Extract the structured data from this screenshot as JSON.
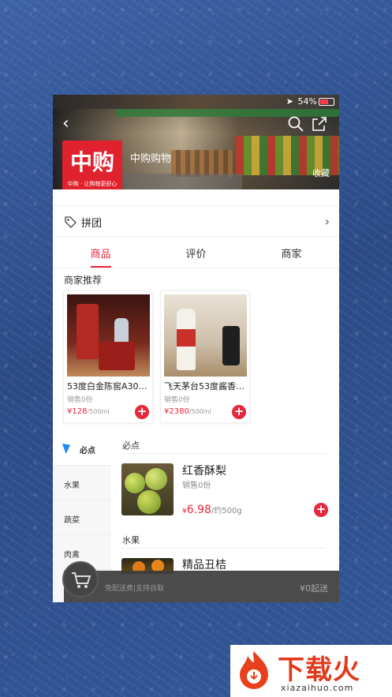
{
  "status_bar": {
    "battery": "54%"
  },
  "header": {
    "shop_name": "中购购物",
    "logo_text": "中购",
    "logo_slogan": "中购 · 让购物更舒心",
    "favorite_label": "收藏"
  },
  "group_buy": {
    "label": "拼团"
  },
  "tabs": [
    {
      "label": "商品",
      "active": true
    },
    {
      "label": "评价",
      "active": false
    },
    {
      "label": "商家",
      "active": false
    }
  ],
  "recommend": {
    "title": "商家推荐",
    "items": [
      {
        "name": "53度白金陈窖A30…",
        "sales": "销售0份",
        "price": "¥128",
        "unit": "/500ml"
      },
      {
        "name": "飞天茅台53度酱香…",
        "sales": "销售0份",
        "price": "¥2380",
        "unit": "/500ml"
      }
    ]
  },
  "categories": [
    {
      "label": "必点",
      "active": true
    },
    {
      "label": "水果",
      "active": false
    },
    {
      "label": "蔬菜",
      "active": false
    },
    {
      "label": "肉禽",
      "active": false
    }
  ],
  "sections": [
    {
      "title": "必点",
      "products": [
        {
          "name": "红香酥梨",
          "sales": "销售0份",
          "yen": "¥",
          "price": "6.98",
          "unit": "/约500g"
        }
      ]
    },
    {
      "title": "水果",
      "products": [
        {
          "name": "精品丑桔"
        }
      ]
    }
  ],
  "cart": {
    "tip": "免配送费|支持自取",
    "min_order": "¥0起送"
  },
  "watermark": {
    "text": "下载火",
    "url": "xiazaihuo.com"
  },
  "colors": {
    "accent": "#e5283b",
    "logo_red": "#e0222e",
    "cursor_blue": "#1e8cf0"
  }
}
